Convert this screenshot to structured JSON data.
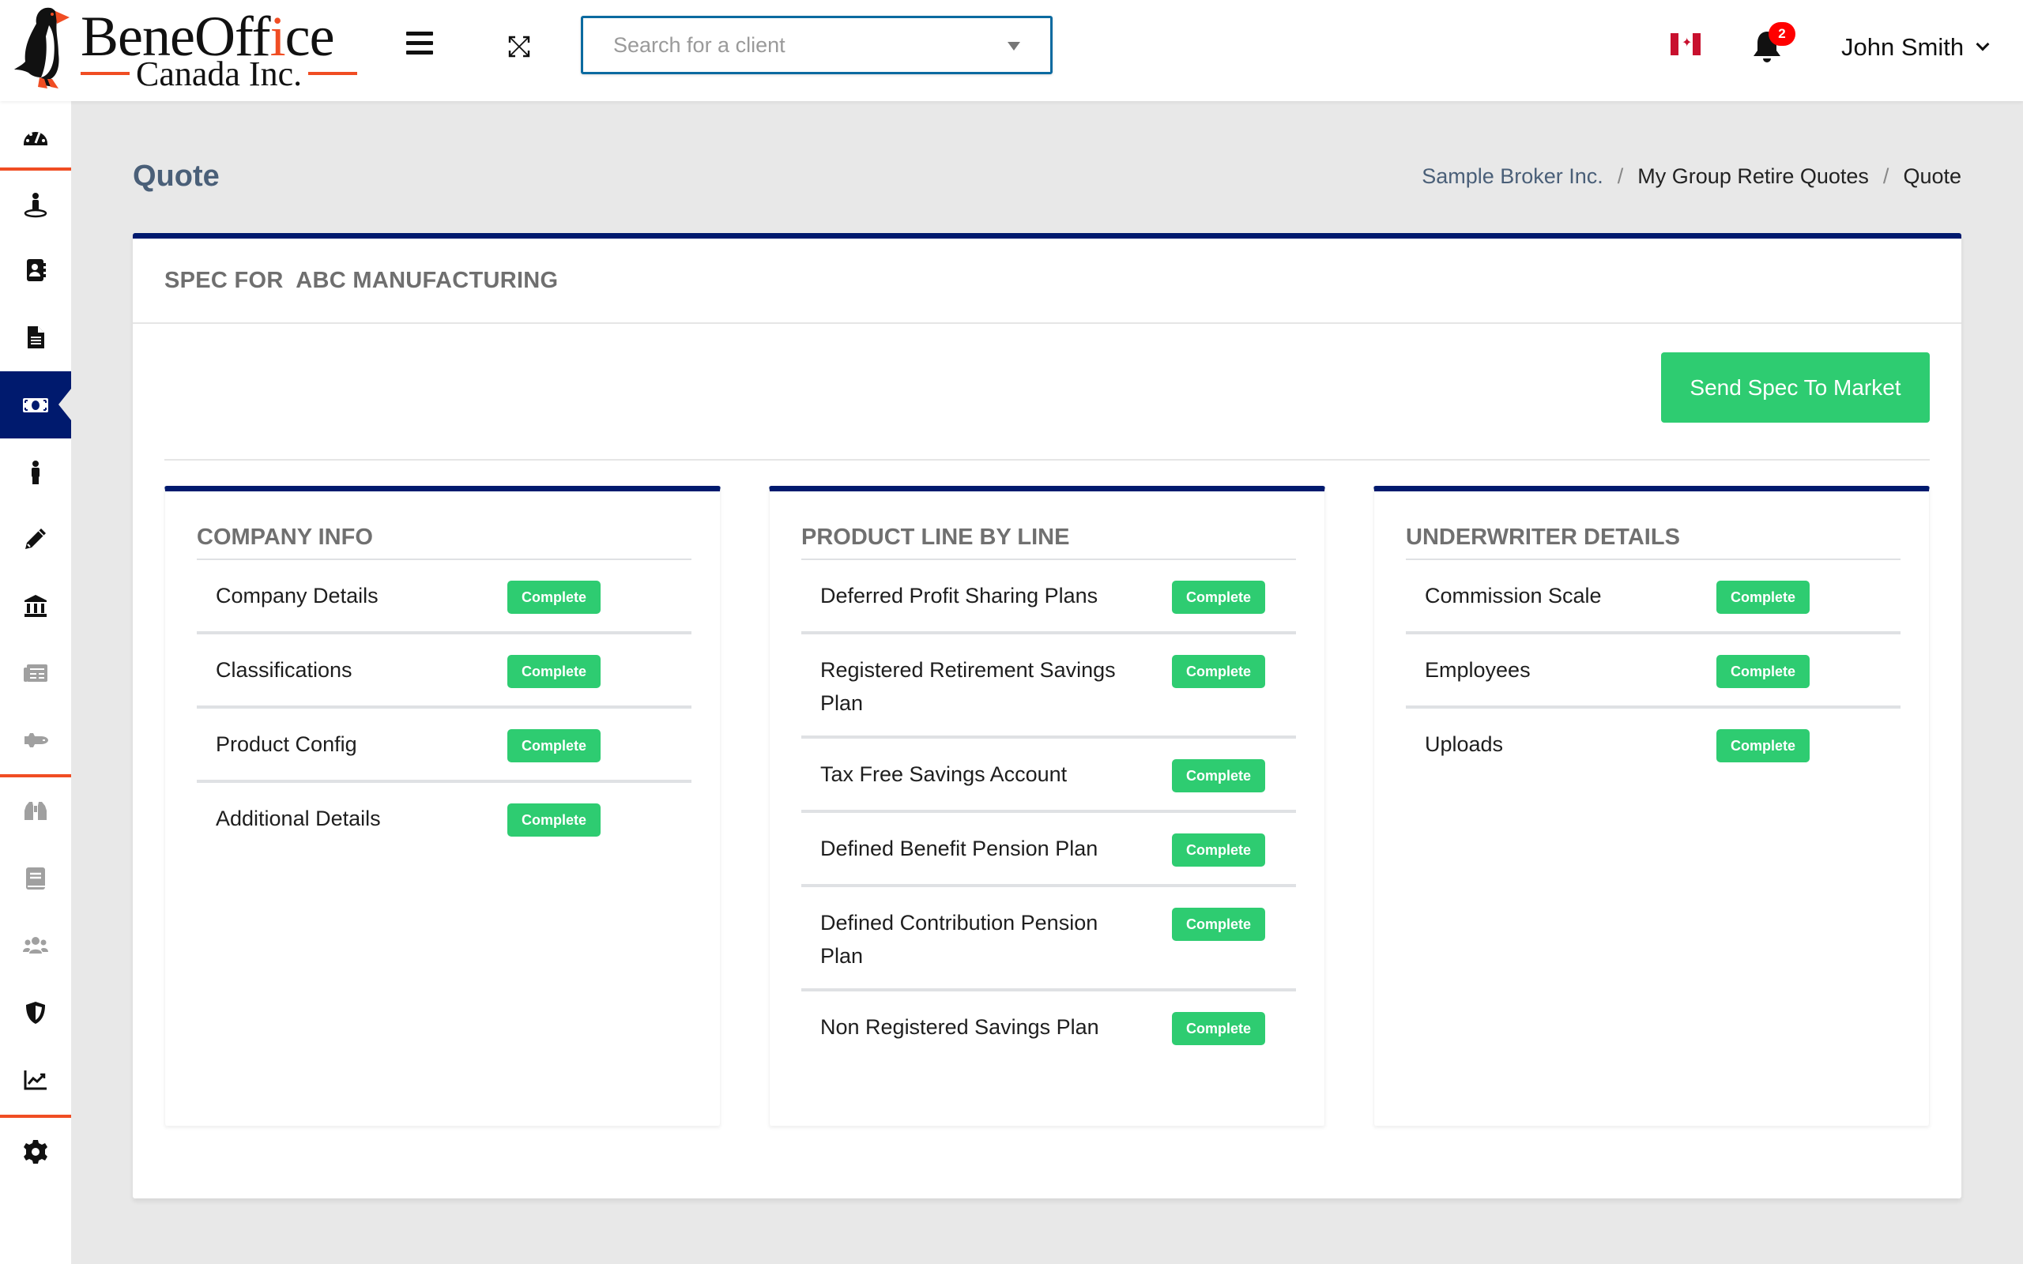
{
  "header": {
    "logo": {
      "brand_main": "BeneOff",
      "brand_dot_char": "i",
      "brand_end": "ce",
      "brand_sub": "Canada Inc."
    },
    "search": {
      "placeholder": "Search for a client",
      "value": ""
    },
    "notifications": {
      "count": "2"
    },
    "user": {
      "name": "John Smith"
    },
    "icons": {
      "menu": "hamburger-icon",
      "expand": "fullscreen-icon",
      "flag": "canada-flag-icon",
      "bell": "bell-icon",
      "chevron": "chevron-down-icon"
    }
  },
  "sidebar": {
    "items": [
      {
        "icon": "dashboard-gauge-icon",
        "active": false,
        "muted": false
      },
      {
        "icon": "person-location-icon",
        "active": false,
        "muted": false
      },
      {
        "icon": "address-book-icon",
        "active": false,
        "muted": false
      },
      {
        "icon": "document-icon",
        "active": false,
        "muted": false
      },
      {
        "icon": "money-bill-icon",
        "active": true,
        "muted": false
      },
      {
        "icon": "person-icon",
        "active": false,
        "muted": false
      },
      {
        "icon": "pencil-icon",
        "active": false,
        "muted": false
      },
      {
        "icon": "bank-icon",
        "active": false,
        "muted": false
      },
      {
        "icon": "newspaper-icon",
        "active": false,
        "muted": true
      },
      {
        "icon": "space-shuttle-icon",
        "active": false,
        "muted": true
      },
      {
        "icon": "binoculars-icon",
        "active": false,
        "muted": true
      },
      {
        "icon": "book-icon",
        "active": false,
        "muted": true
      },
      {
        "icon": "users-icon",
        "active": false,
        "muted": true
      },
      {
        "icon": "shield-icon",
        "active": false,
        "muted": false
      },
      {
        "icon": "chart-line-icon",
        "active": false,
        "muted": false
      },
      {
        "icon": "gear-icon",
        "active": false,
        "muted": false
      }
    ]
  },
  "page": {
    "title": "Quote",
    "breadcrumb": [
      "Sample Broker Inc.",
      "My Group Retire Quotes",
      "Quote"
    ],
    "breadcrumb_sep": "/"
  },
  "spec": {
    "title": "SPEC FOR  ABC MANUFACTURING",
    "send_button": "Send Spec To Market",
    "sections": [
      {
        "title": "COMPANY INFO",
        "items": [
          {
            "label": "Company Details",
            "status": "Complete"
          },
          {
            "label": "Classifications",
            "status": "Complete"
          },
          {
            "label": "Product Config",
            "status": "Complete"
          },
          {
            "label": "Additional Details",
            "status": "Complete"
          }
        ]
      },
      {
        "title": "PRODUCT LINE BY LINE",
        "items": [
          {
            "label": "Deferred Profit Sharing Plans",
            "status": "Complete"
          },
          {
            "label": "Registered Retirement Savings Plan",
            "status": "Complete"
          },
          {
            "label": "Tax Free Savings Account",
            "status": "Complete"
          },
          {
            "label": "Defined Benefit Pension Plan",
            "status": "Complete"
          },
          {
            "label": "Defined Contribution Pension Plan",
            "status": "Complete"
          },
          {
            "label": "Non Registered Savings Plan",
            "status": "Complete"
          }
        ]
      },
      {
        "title": "UNDERWRITER DETAILS",
        "items": [
          {
            "label": "Commission Scale",
            "status": "Complete"
          },
          {
            "label": "Employees",
            "status": "Complete"
          },
          {
            "label": "Uploads",
            "status": "Complete"
          }
        ]
      }
    ]
  },
  "colors": {
    "navy": "#001a6e",
    "accent_orange": "#f04d23",
    "success_green": "#2ecc71",
    "title_slate": "#4a5f78",
    "notification_red": "#ff0000"
  }
}
